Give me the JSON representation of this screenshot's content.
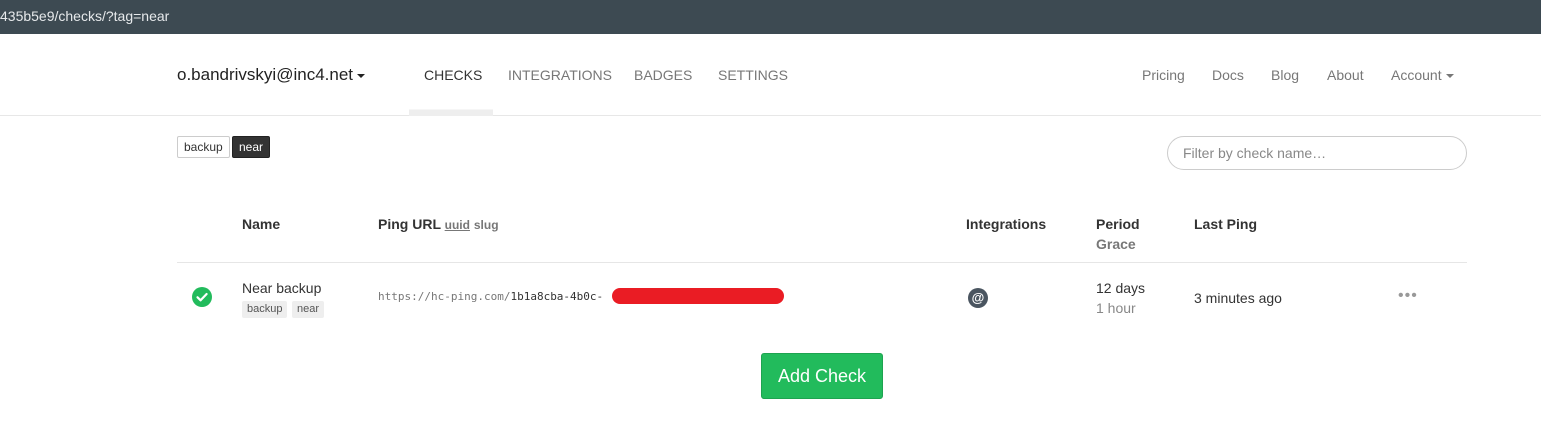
{
  "browser": {
    "url": "435b5e9/checks/?tag=near"
  },
  "navbar": {
    "account": "o.bandrivskyi@inc4.net",
    "nav_items": [
      "CHECKS",
      "INTEGRATIONS",
      "BADGES",
      "SETTINGS"
    ],
    "active_item": "CHECKS",
    "right_items": [
      "Pricing",
      "Docs",
      "Blog",
      "About",
      "Account"
    ]
  },
  "tags": [
    {
      "label": "backup",
      "active": false
    },
    {
      "label": "near",
      "active": true
    }
  ],
  "search": {
    "placeholder": "Filter by check name…"
  },
  "table": {
    "headers": {
      "name": "Name",
      "ping_url": "Ping URL",
      "uuid": "uuid",
      "slug": "slug",
      "integrations": "Integrations",
      "period": "Period",
      "grace": "Grace",
      "last_ping": "Last Ping"
    },
    "rows": [
      {
        "status": "up",
        "name": "Near backup",
        "tags": [
          "backup",
          "near"
        ],
        "ping_url_base": "https://hc-ping.com/",
        "ping_url_uuid": "1b1a8cba-4b0c-",
        "integration_icon": "@",
        "period": "12 days",
        "grace": "1 hour",
        "last_ping": "3 minutes ago",
        "menu": "•••"
      }
    ]
  },
  "add_check_label": "Add Check",
  "colors": {
    "accent_green": "#22bb5c",
    "redaction": "#ea1c24",
    "urlbar": "#3d4a52"
  }
}
